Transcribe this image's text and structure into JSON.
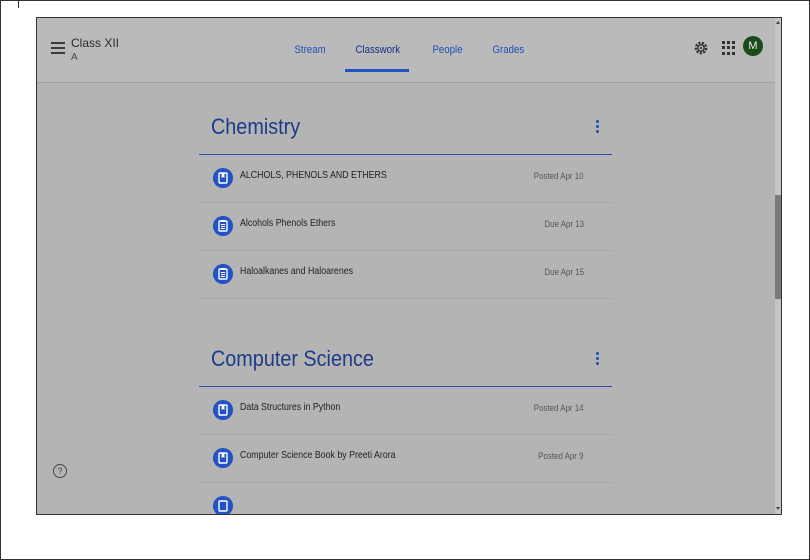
{
  "header": {
    "class_title": "Class XII",
    "class_section": "A",
    "tabs": [
      {
        "label": "Stream"
      },
      {
        "label": "Classwork"
      },
      {
        "label": "People"
      },
      {
        "label": "Grades"
      }
    ],
    "active_tab": "Classwork",
    "avatar_letter": "M"
  },
  "sections": [
    {
      "title": "Chemistry",
      "items": [
        {
          "label": "ALCHOLS, PHENOLS AND ETHERS",
          "date": "Posted Apr 10",
          "icon": "book-icon"
        },
        {
          "label": "Alcohols Phenols Ethers",
          "date": "Due Apr 13",
          "icon": "assignment-icon"
        },
        {
          "label": "Haloalkanes and Haloarenes",
          "date": "Due Apr 15",
          "icon": "assignment-icon"
        }
      ]
    },
    {
      "title": "Computer Science",
      "items": [
        {
          "label": "Data Structures in Python",
          "date": "Posted Apr 14",
          "icon": "book-icon"
        },
        {
          "label": "Computer Science Book by Preeti Arora",
          "date": "Posted Apr 9",
          "icon": "book-icon"
        },
        {
          "label": "",
          "date": "",
          "icon": "book-icon"
        }
      ]
    }
  ],
  "help_icon": "?",
  "colors": {
    "accent": "#2452c4",
    "overlay": "#b4b4b4",
    "avatar_bg": "#1b4a1b"
  }
}
